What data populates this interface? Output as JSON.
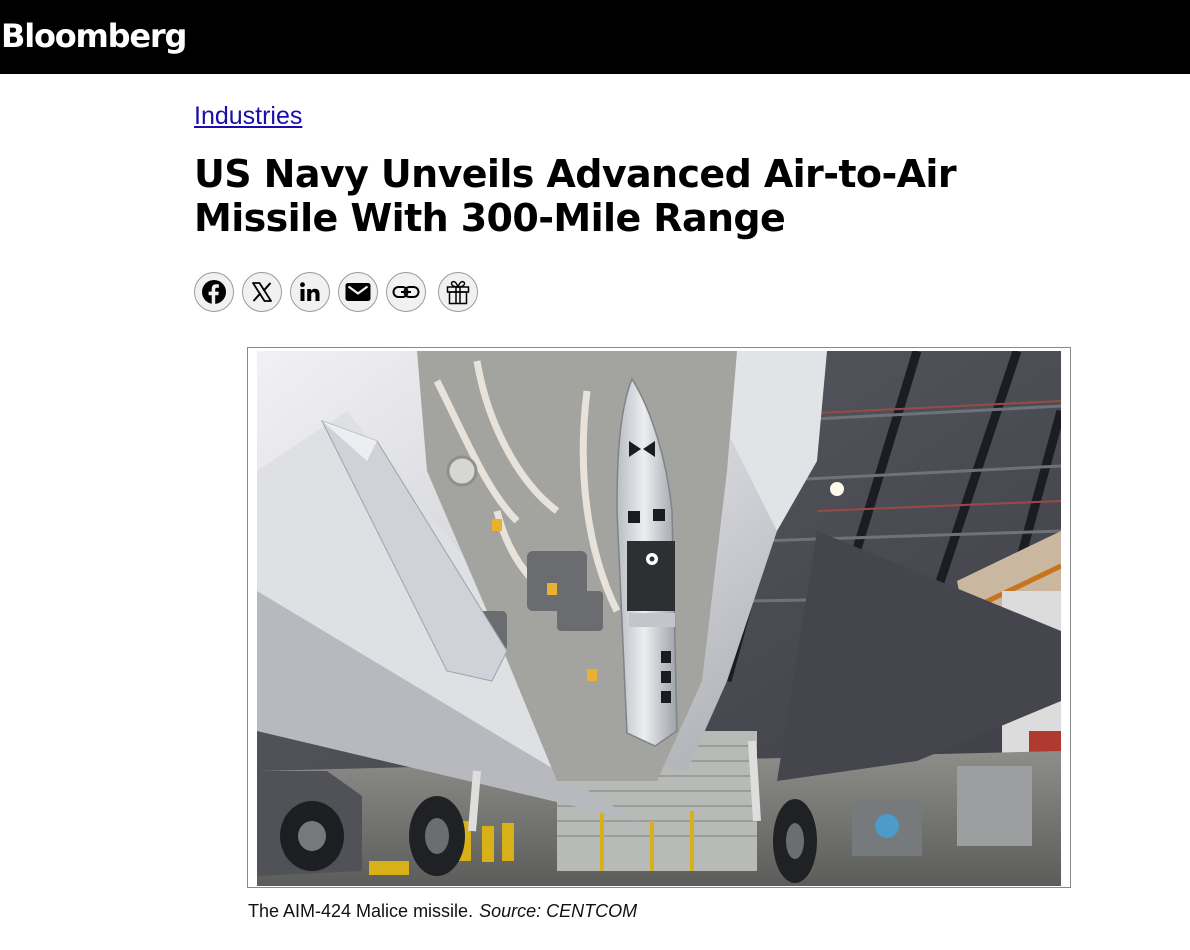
{
  "header": {
    "brand": "Bloomberg"
  },
  "article": {
    "category": "Industries",
    "title": "US Navy Unveils Advanced Air-to-Air Missile With 300-Mile Range"
  },
  "share": [
    {
      "icon": "facebook-icon",
      "label": "Facebook"
    },
    {
      "icon": "x-icon",
      "label": "X"
    },
    {
      "icon": "linkedin-icon",
      "label": "LinkedIn"
    },
    {
      "icon": "email-icon",
      "label": "Email"
    },
    {
      "icon": "link-icon",
      "label": "Copy link"
    },
    {
      "icon": "gift-icon",
      "label": "Gift this article"
    }
  ],
  "figure": {
    "caption": "The AIM-424 Malice missile.",
    "source": "Source: CENTCOM"
  },
  "colors": {
    "topbar": "#000000",
    "link": "#1a0dab",
    "share_bg": "#f1f1f1"
  }
}
